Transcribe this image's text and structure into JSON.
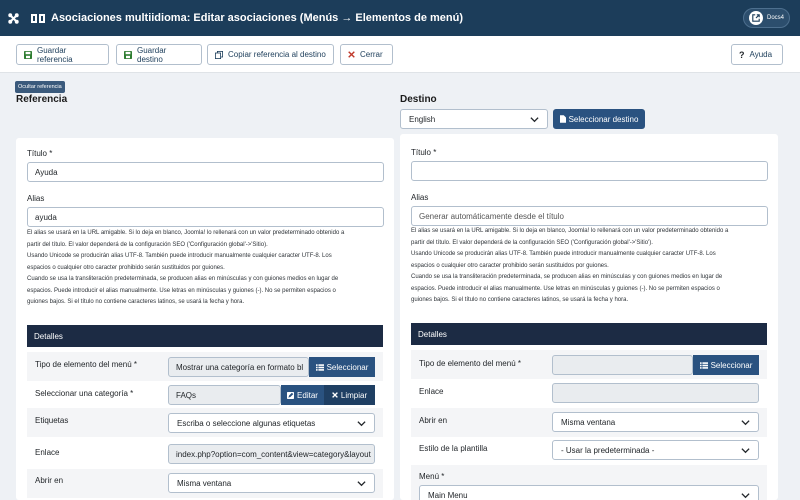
{
  "header": {
    "title": "Asociaciones multiidioma: Editar asociaciones (Menús → Elementos de menú)",
    "docs_label": "Docs4"
  },
  "toolbar": {
    "save_reference": "Guardar referencia",
    "save_target": "Guardar destino",
    "copy_reference": "Copiar referencia al destino",
    "close": "Cerrar",
    "help": "Ayuda"
  },
  "hide_reference_label": "Ocultar referencia",
  "reference": {
    "heading": "Referencia",
    "title_label": "Título *",
    "title_value": "Ayuda",
    "alias_label": "Alias",
    "alias_value": "ayuda",
    "alias_help": [
      "El alias se usará en la URL amigable. Si lo deja en blanco, Joomla! lo rellenará con un valor predeterminado obtenido a",
      "partir del título. El valor dependerá de la configuración SEO ('Configuración global'->'Sitio).",
      "Usando Unicode se producirán alias UTF-8. También puede introducir manualmente cualquier caracter UTF-8. Los",
      "espacios o cualquier otro caracter prohibido serán sustituidos por guiones.",
      "Cuando se usa la transliteración predeterminada, se producen alias en minúsculas y con guiones medios en lugar de",
      "espacios. Puede introducir el alias manualmente. Use letras en minúsculas y guiones (-). No se permiten espacios o",
      "guiones bajos. Si el título no contiene caracteres latinos, se usará la fecha y hora."
    ],
    "details_heading": "Detalles",
    "menu_item_type_label": "Tipo de elemento del menú *",
    "menu_item_type_value": "Mostrar una categoría en formato bl",
    "select_button": "Seleccionar",
    "category_label": "Seleccionar una categoría *",
    "category_value": "FAQs",
    "edit_button": "Editar",
    "clear_button": "Limpiar",
    "tags_label": "Etiquetas",
    "tags_placeholder": "Escriba o seleccione algunas etiquetas",
    "link_label": "Enlace",
    "link_value": "index.php?option=com_content&view=category&layout",
    "open_in_label": "Abrir en",
    "open_in_value": "Misma ventana"
  },
  "target": {
    "heading": "Destino",
    "language_value": "English",
    "select_target_button": "Seleccionar destino",
    "title_label": "Título *",
    "title_value": "",
    "alias_label": "Alias",
    "alias_placeholder": "Generar automáticamente desde el título",
    "alias_help": [
      "El alias se usará en la URL amigable. Si lo deja en blanco, Joomla! lo rellenará con un valor predeterminado obtenido a",
      "partir del título. El valor dependerá de la configuración SEO ('Configuración global'->'Sitio').",
      "Usando Unicode se producirán alias UTF-8. También puede introducir manualmente cualquier caracter UTF-8. Los",
      "espacios o cualquier otro caracter prohibido serán sustituidos por guiones.",
      "Cuando se usa la transliteración predeterminada, se producen alias en minúsculas y con guiones medios en lugar de",
      "espacios. Puede introducir el alias manualmente. Use letras en minúsculas y guiones (-). No se permiten espacios o",
      "guiones bajos. Si el título no contiene caracteres latinos, se usará la fecha y hora."
    ],
    "details_heading": "Detalles",
    "menu_item_type_label": "Tipo de elemento del menú *",
    "select_button": "Seleccionar",
    "link_label": "Enlace",
    "open_in_label": "Abrir en",
    "open_in_value": "Misma ventana",
    "template_style_label": "Estilo de la plantilla",
    "template_style_value": "- Usar la predeterminada -",
    "menu_label": "Menú *",
    "menu_value": "Main Menu"
  },
  "colors": {
    "header_bg": "#1c3d5a",
    "details_bg": "#1c2b44",
    "primary_button": "#2a5280"
  }
}
